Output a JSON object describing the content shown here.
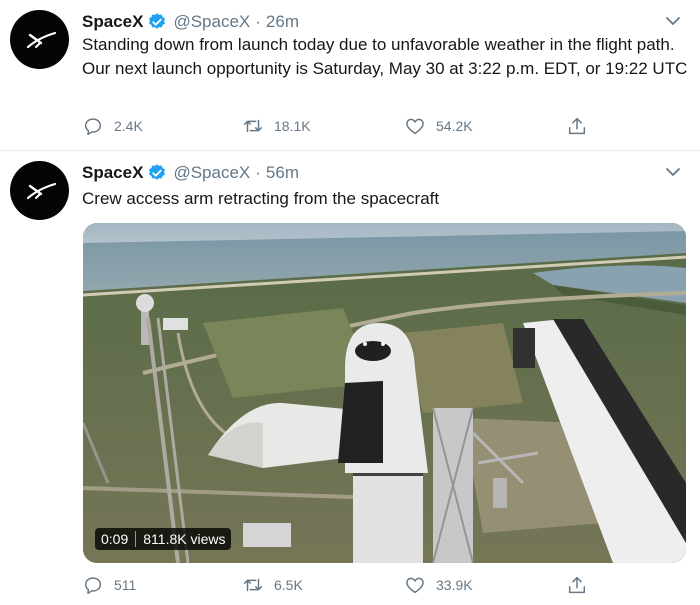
{
  "colors": {
    "text": "#14171a",
    "secondary": "#657786",
    "verified": "#1da1f2",
    "divider": "#e6ecf0"
  },
  "tweets": [
    {
      "name": "SpaceX",
      "handle": "@SpaceX",
      "separator": "·",
      "time": "26m",
      "text": "Standing down from launch today due to unfavorable weather in the flight path. Our next launch opportunity is Saturday, May 30 at 3:22 p.m. EDT, or 19:22 UTC",
      "replies": "2.4K",
      "retweets": "18.1K",
      "likes": "54.2K",
      "icons": {
        "avatar": "spacex-logo",
        "verified": "verified-badge-icon",
        "more": "chevron-down-icon"
      }
    },
    {
      "name": "SpaceX",
      "handle": "@SpaceX",
      "separator": "·",
      "time": "56m",
      "text": "Crew access arm retracting from the spacecraft",
      "video": {
        "time": "0:09",
        "views": "811.8K views"
      },
      "replies": "511",
      "retweets": "6.5K",
      "likes": "33.9K",
      "icons": {
        "avatar": "spacex-logo",
        "verified": "verified-badge-icon",
        "more": "chevron-down-icon"
      }
    }
  ]
}
